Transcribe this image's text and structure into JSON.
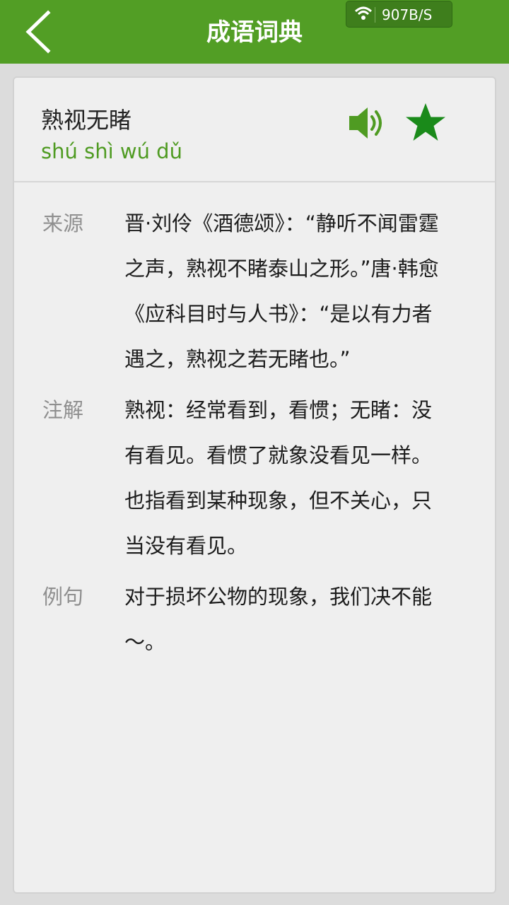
{
  "header": {
    "title": "成语词典",
    "network_speed": "907B/S"
  },
  "idiom": {
    "word": "熟视无睹",
    "pinyin": "shú shì wú dǔ"
  },
  "sections": {
    "source": {
      "label": "来源",
      "lines": [
        "晋·刘伶《酒德颂》：“静听不闻雷霆",
        "之声，熟视不睹泰山之形。”唐·韩愈",
        "《应科目时与人书》：“是以有力者",
        "遇之，熟视之若无睹也。”"
      ]
    },
    "annotation": {
      "label": "注解",
      "lines": [
        "熟视：经常看到，看惯；无睹：没",
        "有看见。看惯了就象没看见一样。",
        "也指看到某种现象，但不关心，只",
        "当没有看见。"
      ]
    },
    "example": {
      "label": "例句",
      "lines": [
        "对于损坏公物的现象，我们决不能",
        "～。"
      ]
    }
  },
  "colors": {
    "header_green": "#529e25",
    "pinyin_green": "#4f9b22",
    "icon_green": "#4f9b22",
    "star_green": "#1a8a1a"
  },
  "icons": {
    "back": "chevron-left-icon",
    "wifi": "wifi-icon",
    "speaker": "speaker-icon",
    "favorite": "star-icon"
  }
}
